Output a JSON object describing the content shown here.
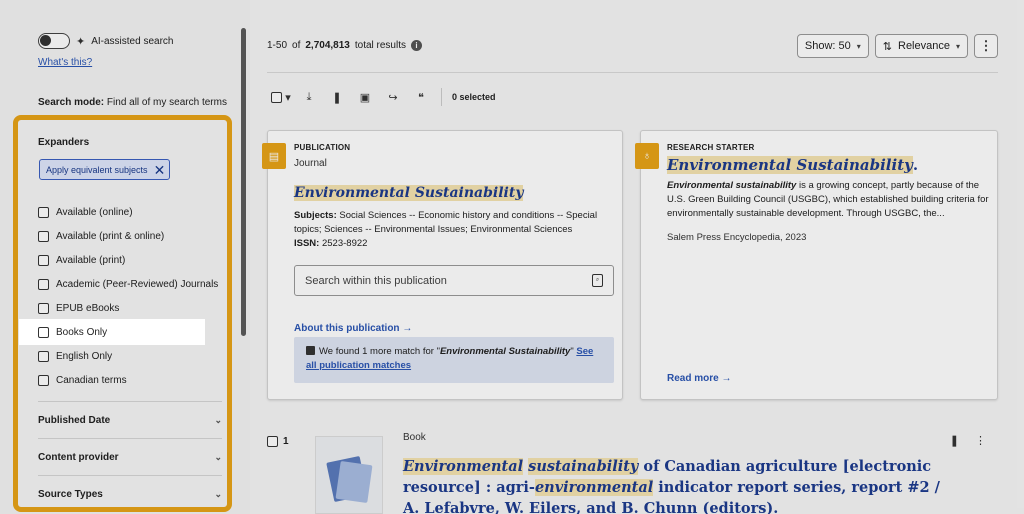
{
  "sidebar": {
    "ai_label": "AI-assisted search",
    "whats_this": "What's this?",
    "search_mode_label": "Search mode:",
    "search_mode_value": "Find all of my search terms",
    "expanders_title": "Expanders",
    "chip_label": "Apply equivalent subjects",
    "expanders": [
      {
        "label": "Available (online)"
      },
      {
        "label": "Available (print & online)"
      },
      {
        "label": "Available (print)"
      },
      {
        "label": "Academic (Peer-Reviewed) Journals"
      },
      {
        "label": "EPUB eBooks"
      },
      {
        "label": "Books Only"
      },
      {
        "label": "English Only"
      },
      {
        "label": "Canadian terms"
      }
    ],
    "facets": [
      {
        "label": "Published Date"
      },
      {
        "label": "Content provider"
      },
      {
        "label": "Source Types"
      }
    ]
  },
  "header": {
    "range": "1-50",
    "of": "of",
    "total": "2,704,813",
    "suffix": "total results",
    "show_label": "Show: 50",
    "sort_label": "Relevance"
  },
  "toolbar": {
    "selected": "0 selected"
  },
  "publication_card": {
    "kicker": "PUBLICATION",
    "type": "Journal",
    "title": "Environmental Sustainability",
    "subjects_label": "Subjects:",
    "subjects": "Social Sciences -- Economic history and conditions -- Special topics; Sciences -- Environmental Issues; Environmental Sciences",
    "issn_label": "ISSN:",
    "issn": "2523-8922",
    "search_within": "Search within this publication",
    "about_link": "About this publication",
    "match_prefix": "We found 1 more match for \"",
    "match_term": "Environmental Sustainability",
    "match_suffix": "\"",
    "match_link": "See all publication matches"
  },
  "research_card": {
    "kicker": "RESEARCH STARTER",
    "title": "Environmental Sustainability",
    "title_suffix": ".",
    "desc_em": "Environmental sustainability",
    "desc_rest": " is a growing concept, partly because of the U.S. Green Building Council (USGBC), which established building criteria for environmentally sustainable development. Through USGBC, the...",
    "source": "Salem Press Encyclopedia, 2023",
    "read_more": "Read more"
  },
  "result": {
    "number": "1",
    "type": "Book",
    "title_parts": [
      {
        "t": "Environmental",
        "em": true
      },
      {
        "t": " ",
        "em": false
      },
      {
        "t": "sustainability",
        "em": true
      },
      {
        "t": " of Canadian agriculture [electronic resource] : agri-",
        "em": false
      },
      {
        "t": "environmental",
        "em": true
      },
      {
        "t": " indicator report series, report #2 / A. Lefabvre, W. Eilers, and B. Chunn (editors).",
        "em": false
      }
    ]
  },
  "colors": {
    "accent": "#e8a317",
    "link": "#2b56b5",
    "title": "#1d3b8f"
  }
}
